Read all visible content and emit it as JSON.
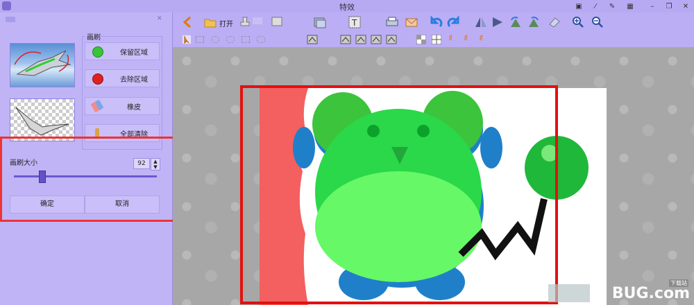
{
  "window": {
    "title": "特效"
  },
  "toolbar": {
    "open_label": "打开",
    "row1_icons": [
      "back-arrow-icon",
      "open-folder-icon",
      "stamp-icon",
      "stamp2-icon",
      "image-icon",
      "text-icon",
      "printer-icon",
      "mail-icon",
      "undo-icon",
      "redo-icon",
      "flip-horizontal-icon",
      "flip-vertical-icon",
      "rotate-left-icon",
      "rotate-right-icon",
      "eraser-icon",
      "zoom-in-icon",
      "zoom-out-icon"
    ],
    "row2_icons": [
      "select-arrow-icon",
      "rect-select-icon",
      "ellipse-select-icon",
      "lasso-icon",
      "brush-icon",
      "crop-icon",
      "pattern1-icon",
      "pattern2-icon",
      "pattern3-icon",
      "pattern4-icon",
      "checker-icon",
      "grid-icon",
      "hash1-icon",
      "hash2-icon",
      "hash3-icon"
    ]
  },
  "panel": {
    "brush_group_label": "画刷",
    "keep_area": "保留区域",
    "remove_area": "去除区域",
    "eraser": "橡皮",
    "clear_all": "全部清除",
    "brush_size_label": "画刷大小",
    "brush_size_value": "92",
    "brush_size_fraction": 0.2,
    "ok": "确定",
    "cancel": "取消"
  },
  "colors": {
    "accent": "#6a58cf",
    "keep": "#33cc33",
    "remove": "#e02020",
    "annotation": "#e31010"
  },
  "watermark": {
    "text": "Q BUG.com",
    "sub": "下载站"
  }
}
